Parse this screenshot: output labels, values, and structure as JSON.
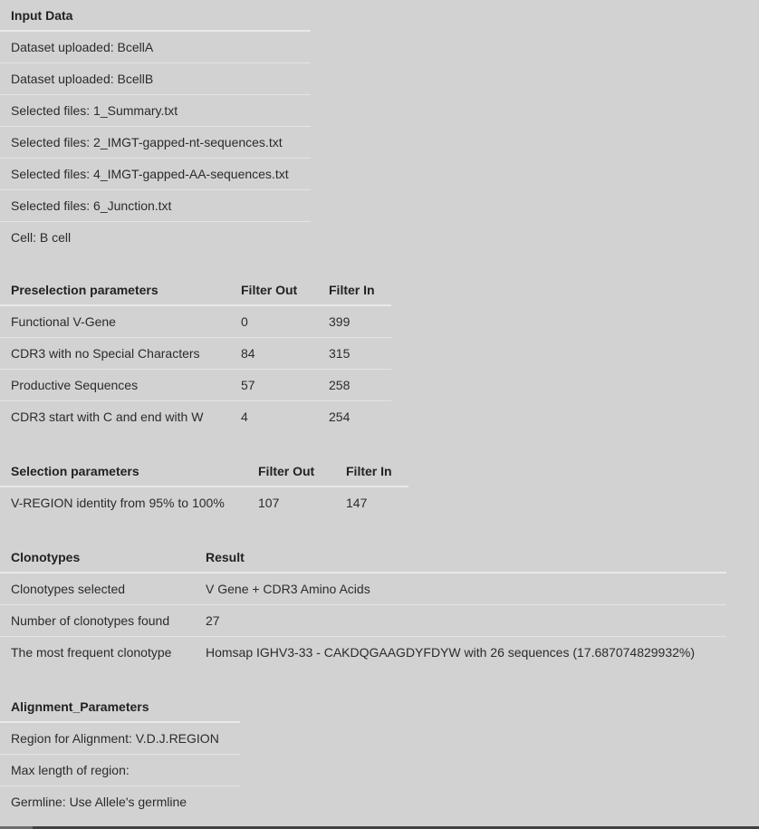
{
  "input_data": {
    "header": "Input Data",
    "rows": [
      "Dataset uploaded: BcellA",
      "Dataset uploaded: BcellB",
      "Selected files: 1_Summary.txt",
      "Selected files: 2_IMGT-gapped-nt-sequences.txt",
      "Selected files: 4_IMGT-gapped-AA-sequences.txt",
      "Selected files: 6_Junction.txt",
      "Cell: B cell"
    ]
  },
  "preselection": {
    "headers": [
      "Preselection parameters",
      "Filter Out",
      "Filter In"
    ],
    "rows": [
      [
        "Functional V-Gene",
        "0",
        "399"
      ],
      [
        "CDR3 with no Special Characters",
        "84",
        "315"
      ],
      [
        "Productive Sequences",
        "57",
        "258"
      ],
      [
        "CDR3 start with C and end with W",
        "4",
        "254"
      ]
    ]
  },
  "selection": {
    "headers": [
      "Selection parameters",
      "Filter Out",
      "Filter In"
    ],
    "rows": [
      [
        "V-REGION identity from 95% to 100%",
        "107",
        "147"
      ]
    ]
  },
  "clonotypes": {
    "headers": [
      "Clonotypes",
      "Result"
    ],
    "rows": [
      [
        "Clonotypes selected",
        "V Gene + CDR3 Amino Acids"
      ],
      [
        "Number of clonotypes found",
        "27"
      ],
      [
        "The most frequent clonotype",
        "Homsap IGHV3-33 - CAKDQGAAGDYFDYW with 26 sequences (17.687074829932%)"
      ]
    ]
  },
  "alignment": {
    "header": "Alignment_Parameters",
    "rows": [
      "Region for Alignment: V.D.J.REGION",
      "Max length of region:",
      "Germline: Use Allele's germline"
    ]
  }
}
